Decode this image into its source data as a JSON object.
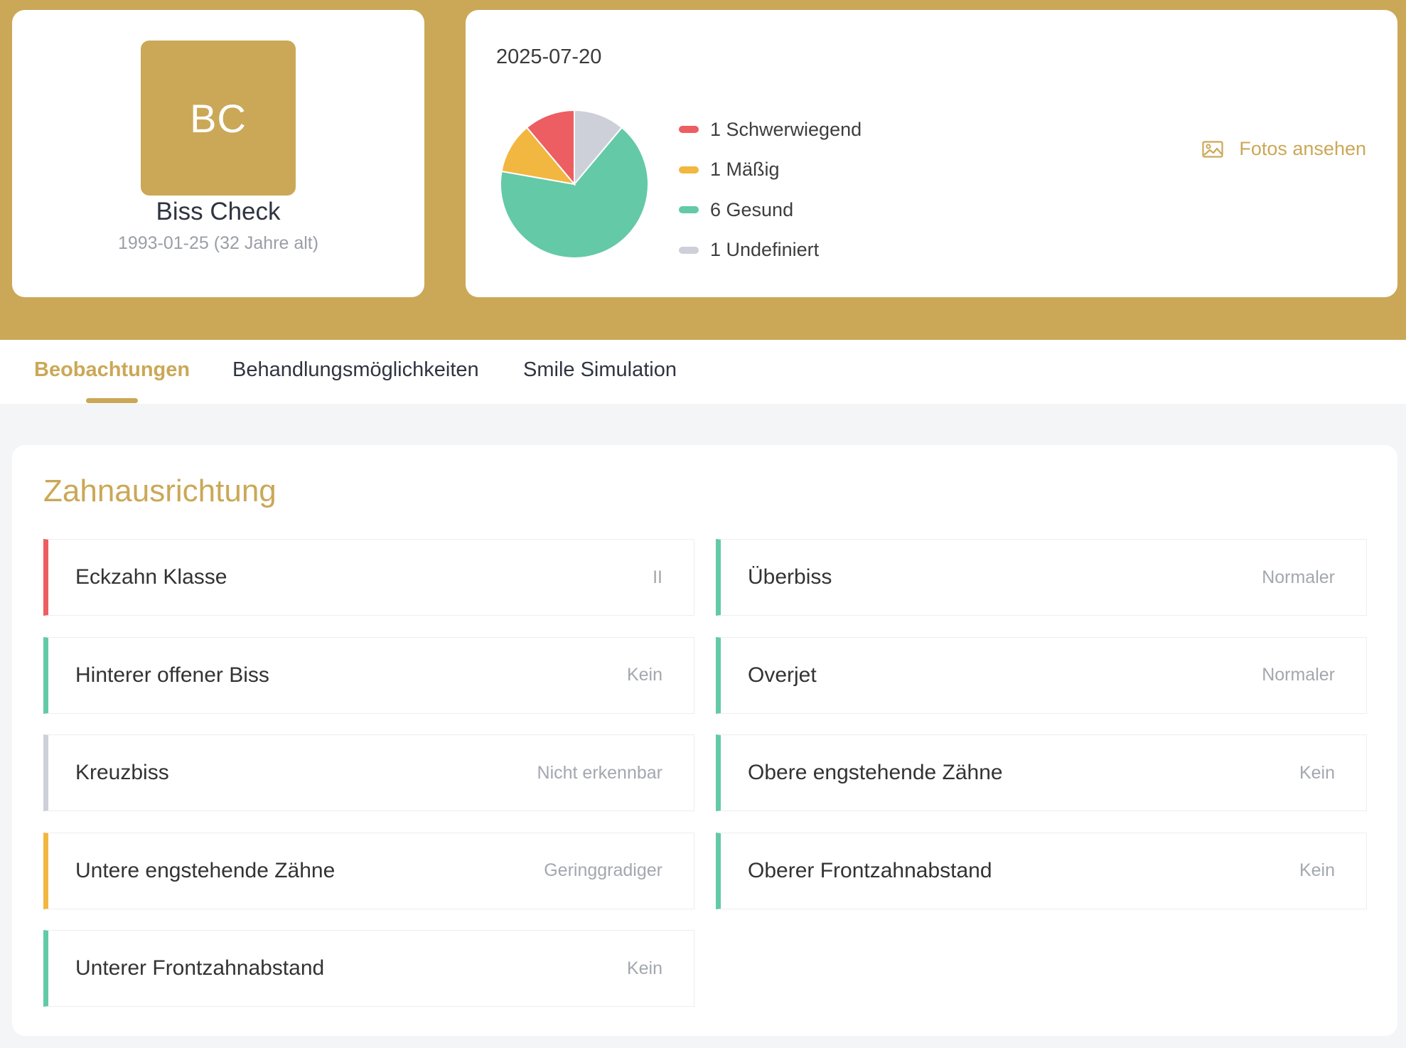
{
  "profile": {
    "initials": "BC",
    "name": "Biss Check",
    "dob": "1993-01-25 (32 Jahre alt)"
  },
  "summary": {
    "date": "2025-07-20",
    "photos_label": "Fotos ansehen",
    "photos_icon": "image-icon"
  },
  "chart_data": {
    "type": "pie",
    "slices": [
      {
        "label": "1 Undefiniert",
        "value": 1,
        "color": "#cdd0d8"
      },
      {
        "label": "6 Gesund",
        "value": 6,
        "color": "#63c9a7"
      },
      {
        "label": "1 Mäßig",
        "value": 1,
        "color": "#f2b740"
      },
      {
        "label": "1 Schwerwiegend",
        "value": 1,
        "color": "#ec5e62"
      }
    ],
    "legend": [
      {
        "label": "1 Schwerwiegend",
        "color": "#ec5e62"
      },
      {
        "label": "1 Mäßig",
        "color": "#f2b740"
      },
      {
        "label": "6 Gesund",
        "color": "#63c9a7"
      },
      {
        "label": "1 Undefiniert",
        "color": "#cdd0d8"
      }
    ]
  },
  "tabs": [
    {
      "label": "Beobachtungen",
      "active": true
    },
    {
      "label": "Behandlungsmöglichkeiten",
      "active": false
    },
    {
      "label": "Smile Simulation",
      "active": false
    }
  ],
  "section": {
    "title": "Zahnausrichtung",
    "observations": [
      {
        "label": "Eckzahn Klasse",
        "value": "II",
        "color": "#ec5e62"
      },
      {
        "label": "Überbiss",
        "value": "Normaler",
        "color": "#63c9a7"
      },
      {
        "label": "Hinterer offener Biss",
        "value": "Kein",
        "color": "#63c9a7"
      },
      {
        "label": "Overjet",
        "value": "Normaler",
        "color": "#63c9a7"
      },
      {
        "label": "Kreuzbiss",
        "value": "Nicht erkennbar",
        "color": "#cdd0d8"
      },
      {
        "label": "Obere engstehende Zähne",
        "value": "Kein",
        "color": "#63c9a7"
      },
      {
        "label": "Untere engstehende Zähne",
        "value": "Geringgradiger",
        "color": "#f2b740"
      },
      {
        "label": "Oberer Frontzahnabstand",
        "value": "Kein",
        "color": "#63c9a7"
      },
      {
        "label": "Unterer Frontzahnabstand",
        "value": "Kein",
        "color": "#63c9a7"
      }
    ]
  }
}
